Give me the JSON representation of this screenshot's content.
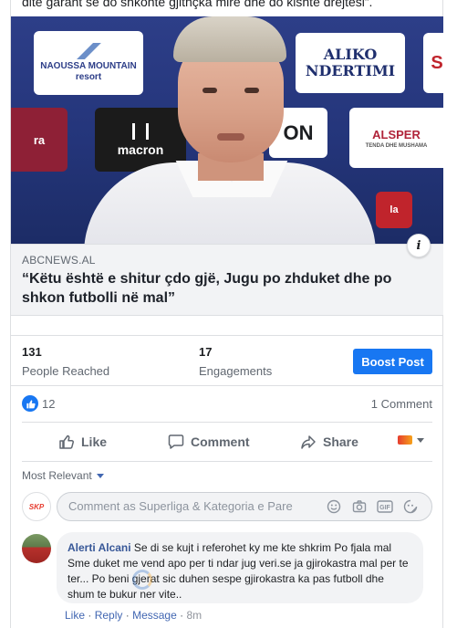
{
  "post": {
    "top_text": "dite garant se do shkonte gjithçka mirë dhe do kishte drejtësi”.",
    "preview": {
      "domain": "ABCNEWS.AL",
      "title": "“Këtu është e shitur çdo gjë, Jugu po zhduket dhe po shkon futbolli në mal”",
      "info_label": "i",
      "image_boards": {
        "naoussa": "NAOUSSA MOUNTAIN",
        "naoussa_sub": "resort",
        "aliko_line1": "ALIKO",
        "aliko_line2": "NDERTIMI",
        "macron": "macron",
        "alsper": "ALSPER",
        "alsper_sub": "TENDA DHE MUSHAMA"
      }
    }
  },
  "stats": {
    "reached": {
      "value": "131",
      "label": "People Reached"
    },
    "engagements": {
      "value": "17",
      "label": "Engagements"
    },
    "boost_label": "Boost Post"
  },
  "reactions": {
    "count": "12",
    "comments": "1 Comment"
  },
  "actions": {
    "like": "Like",
    "comment": "Comment",
    "share": "Share"
  },
  "comments_section": {
    "sort_label": "Most Relevant",
    "composer_placeholder": "Comment as Superliga & Kategoria e Pare",
    "page_avatar_text": "SKP",
    "items": [
      {
        "author": "Alerti Alcani",
        "text": "Se di se kujt i referohet ky me kte shkrim Po fjala mal Sme duket me vend apo per ti ndar jug veri.se ja gjirokastra mal per te ter... Po beni gjerat sic duhen sespe gjirokastra ka pas futboll dhe shum te bukur ner vite..",
        "link_like": "Like",
        "link_reply": "Reply",
        "link_message": "Message",
        "time": "8m"
      }
    ]
  },
  "colors": {
    "brand_blue": "#1877f2",
    "link_blue": "#385898",
    "text_muted": "#606770"
  }
}
